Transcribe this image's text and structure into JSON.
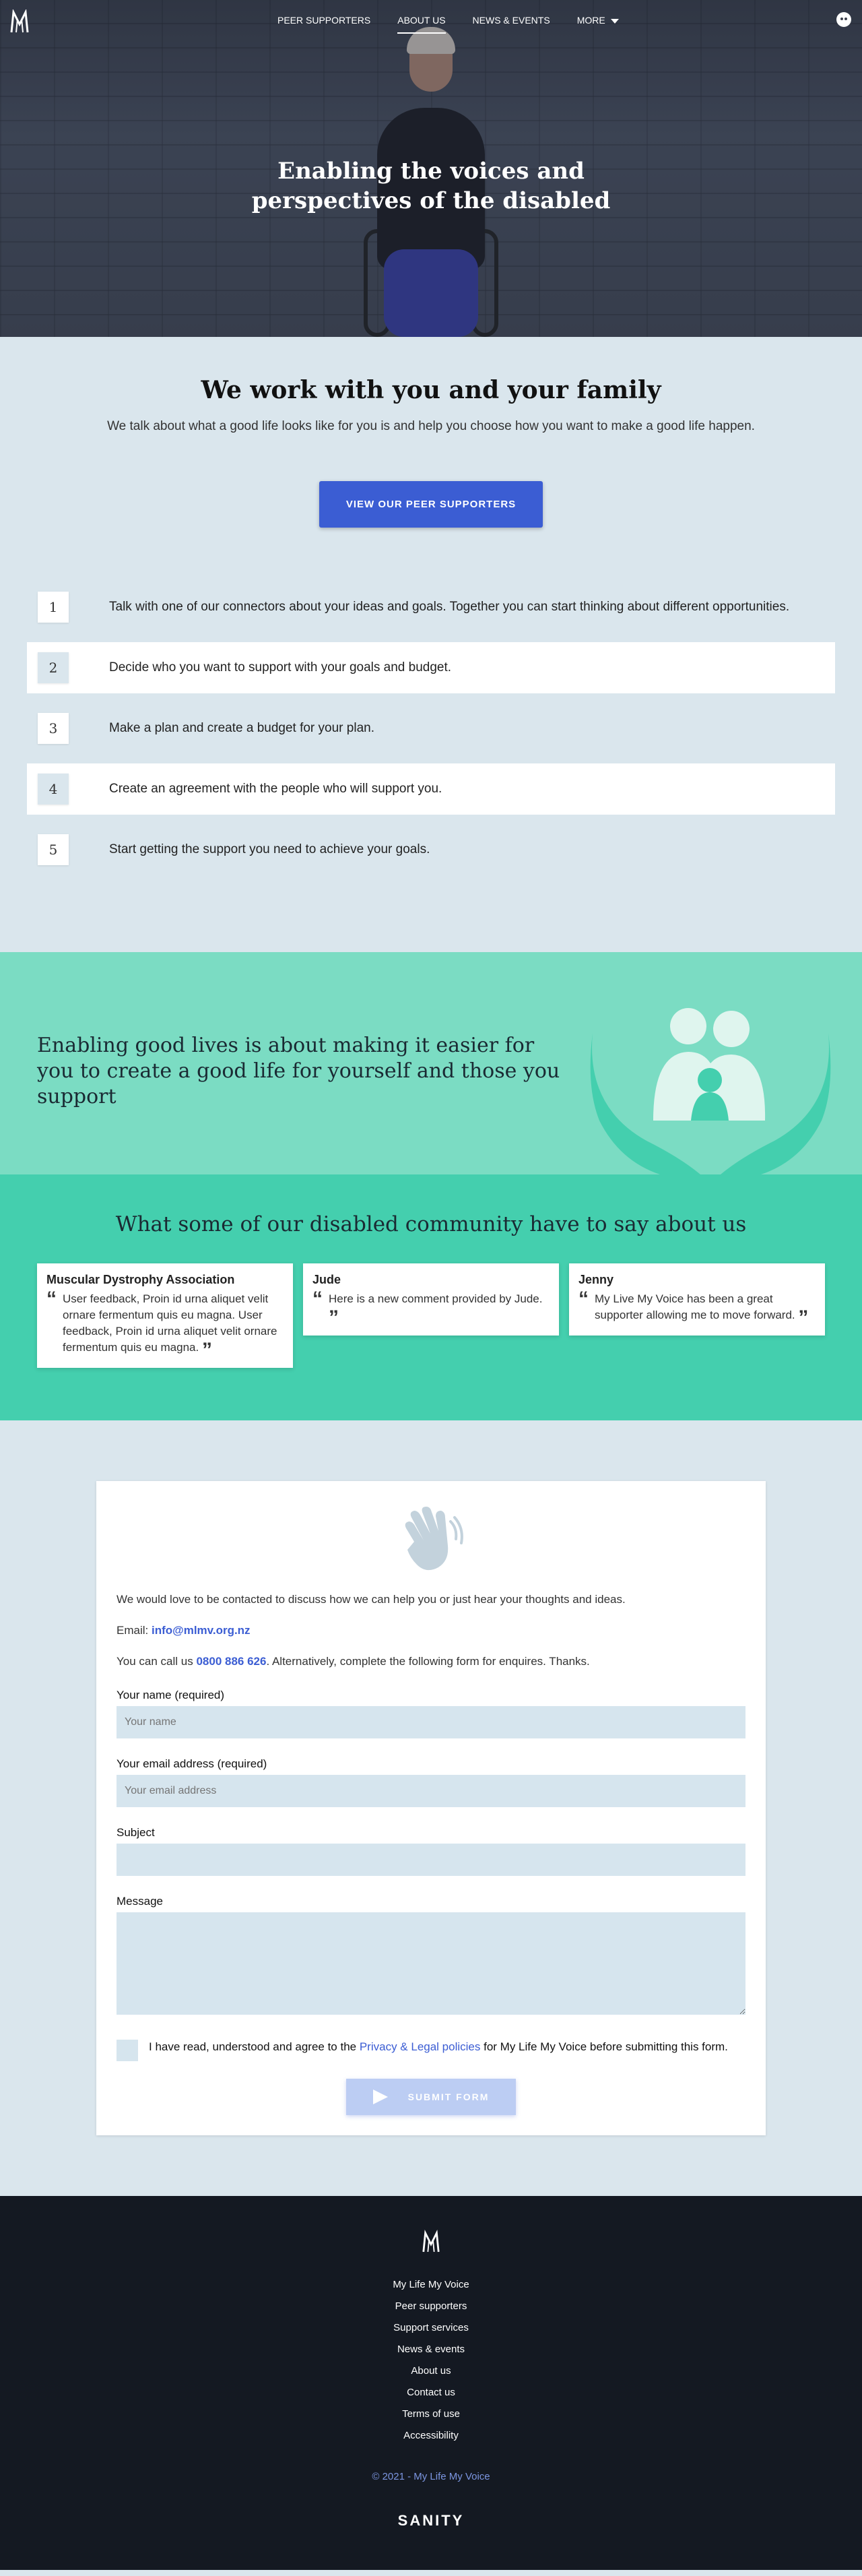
{
  "nav": {
    "links": [
      "PEER SUPPORTERS",
      "ABOUT US",
      "NEWS & EVENTS",
      "MORE"
    ]
  },
  "hero": {
    "title": "Enabling the voices and perspectives of the disabled"
  },
  "family": {
    "title": "We work with you and your family",
    "subtitle": "We talk about what a good life looks like for you is and help you choose how you want to make a good life happen.",
    "button": "VIEW OUR PEER SUPPORTERS"
  },
  "steps": [
    {
      "num": "1",
      "text": "Talk with one of our connectors about your ideas and goals. Together you can start thinking about different opportunities."
    },
    {
      "num": "2",
      "text": "Decide who you want to support with your goals and budget."
    },
    {
      "num": "3",
      "text": "Make a plan and create a budget for your plan."
    },
    {
      "num": "4",
      "text": "Create an agreement with the people who will support you."
    },
    {
      "num": "5",
      "text": "Start getting the support you need to achieve your goals."
    }
  ],
  "banner": {
    "text": "Enabling good lives is about making it easier for you to create a good life for yourself and those you support"
  },
  "testimonials": {
    "title": "What some of our disabled community have to say about us",
    "items": [
      {
        "name": "Muscular Dystrophy Association",
        "quote": "User feedback, Proin id urna aliquet velit ornare fermentum quis eu magna. User feedback, Proin id urna aliquet velit ornare fermentum quis eu magna."
      },
      {
        "name": "Jude",
        "quote": "Here is a new comment provided by Jude."
      },
      {
        "name": "Jenny",
        "quote": "My Live My Voice has been a great supporter allowing me to move forward."
      }
    ]
  },
  "contact": {
    "intro": "We would love to be contacted to discuss how we can help you or just hear your thoughts and ideas.",
    "email_label": "Email: ",
    "email": "info@mlmv.org.nz",
    "phone_prefix": "You can call us ",
    "phone": "0800 886 626",
    "phone_suffix": ". Alternatively, complete the following form for enquires. Thanks.",
    "name_label": "Your name (required)",
    "name_placeholder": "Your name",
    "email_field_label": "Your email address (required)",
    "email_placeholder": "Your email address",
    "subject_label": "Subject",
    "message_label": "Message",
    "agree_prefix": "I have read, understood and agree to the ",
    "agree_link": "Privacy & Legal policies",
    "agree_suffix": " for My Life My Voice before submitting this form.",
    "submit": "SUBMIT FORM"
  },
  "footer": {
    "links": [
      "My Life My Voice",
      "Peer supporters",
      "Support services",
      "News & events",
      "About us",
      "Contact us",
      "Terms of use",
      "Accessibility"
    ],
    "copyright": "© 2021 - My Life My Voice",
    "sanity": "SANITY"
  },
  "colors": {
    "primary": "#3b5dd3",
    "mint": "#7bdcc3",
    "teal": "#44cfae",
    "pale_blue": "#dae6ed",
    "footer": "#141922"
  }
}
